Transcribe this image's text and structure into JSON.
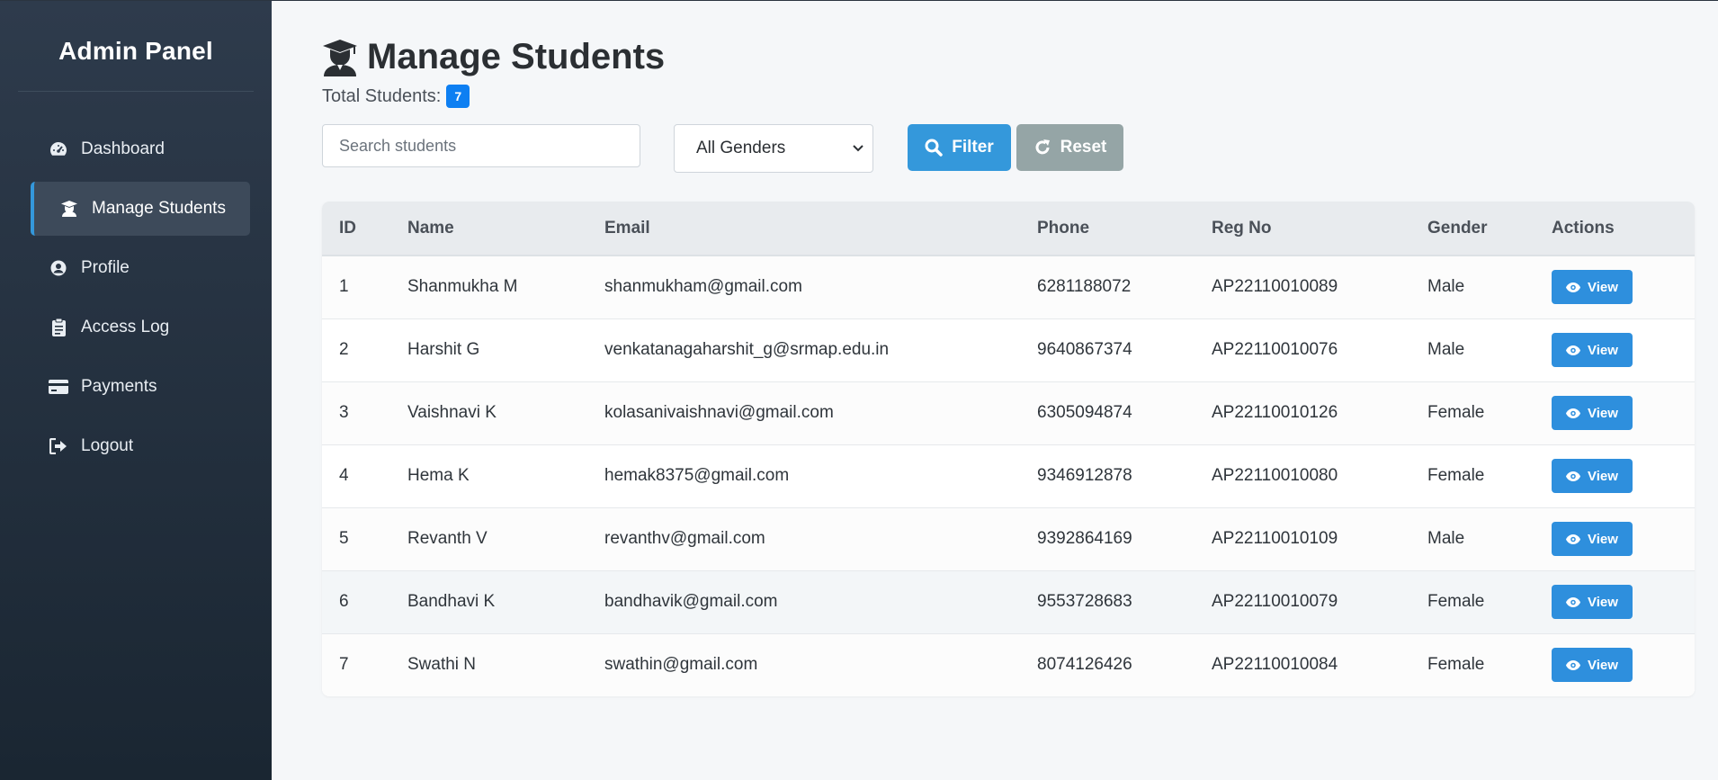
{
  "sidebar": {
    "brand": "Admin Panel",
    "items": [
      {
        "label": "Dashboard",
        "icon": "dashboard-icon",
        "active": false
      },
      {
        "label": "Manage Students",
        "icon": "graduate-icon",
        "active": true
      },
      {
        "label": "Profile",
        "icon": "user-circle-icon",
        "active": false
      },
      {
        "label": "Access Log",
        "icon": "clipboard-icon",
        "active": false
      },
      {
        "label": "Payments",
        "icon": "credit-card-icon",
        "active": false
      },
      {
        "label": "Logout",
        "icon": "logout-icon",
        "active": false
      }
    ]
  },
  "header": {
    "title": "Manage Students",
    "total_label": "Total Students:",
    "total_count": "7"
  },
  "filters": {
    "search_placeholder": "Search students",
    "search_value": "",
    "gender_selected": "All Genders",
    "filter_label": "Filter",
    "reset_label": "Reset"
  },
  "table": {
    "columns": [
      "ID",
      "Name",
      "Email",
      "Phone",
      "Reg No",
      "Gender",
      "Actions"
    ],
    "view_label": "View",
    "rows": [
      {
        "id": "1",
        "name": "Shanmukha M",
        "email": "shanmukham@gmail.com",
        "phone": "6281188072",
        "reg": "AP22110010089",
        "gender": "Male"
      },
      {
        "id": "2",
        "name": "Harshit G",
        "email": "venkatanagaharshit_g@srmap.edu.in",
        "phone": "9640867374",
        "reg": "AP22110010076",
        "gender": "Male"
      },
      {
        "id": "3",
        "name": "Vaishnavi K",
        "email": "kolasanivaishnavi@gmail.com",
        "phone": "6305094874",
        "reg": "AP22110010126",
        "gender": "Female"
      },
      {
        "id": "4",
        "name": "Hema K",
        "email": "hemak8375@gmail.com",
        "phone": "9346912878",
        "reg": "AP22110010080",
        "gender": "Female"
      },
      {
        "id": "5",
        "name": "Revanth V",
        "email": "revanthv@gmail.com",
        "phone": "9392864169",
        "reg": "AP22110010109",
        "gender": "Male"
      },
      {
        "id": "6",
        "name": "Bandhavi K",
        "email": "bandhavik@gmail.com",
        "phone": "9553728683",
        "reg": "AP22110010079",
        "gender": "Female"
      },
      {
        "id": "7",
        "name": "Swathi N",
        "email": "swathin@gmail.com",
        "phone": "8074126426",
        "reg": "AP22110010084",
        "gender": "Female"
      }
    ]
  },
  "colors": {
    "accent": "#3498db",
    "badge": "#0d7ff2",
    "reset": "#95a5a6",
    "sidebar_top": "#2e3b4c",
    "sidebar_bottom": "#1a2632"
  }
}
